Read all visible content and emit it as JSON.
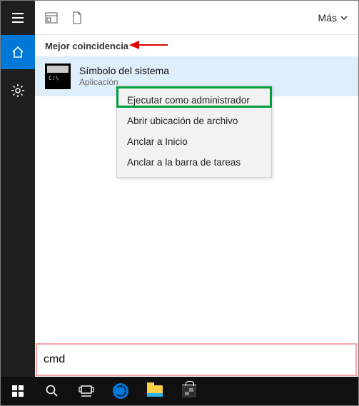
{
  "sidebar": {
    "items": [
      {
        "name": "hamburger"
      },
      {
        "name": "home"
      },
      {
        "name": "settings"
      }
    ]
  },
  "topbar": {
    "mas_label": "Más"
  },
  "section": {
    "best_match_label": "Mejor coincidencia"
  },
  "result": {
    "title": "Símbolo del sistema",
    "subtitle": "Aplicación"
  },
  "context_menu": {
    "items": [
      "Ejecutar como administrador",
      "Abrir ubicación de archivo",
      "Anclar a Inicio",
      "Anclar a la barra de tareas"
    ]
  },
  "search": {
    "value": "cmd",
    "placeholder": ""
  },
  "taskbar": {
    "items": [
      "start",
      "search",
      "task-view",
      "edge",
      "file-explorer",
      "store"
    ]
  },
  "annotations": {
    "red_arrow_target": "best-match-heading",
    "green_highlight_target": "context-run-as-admin",
    "red_box_target": "search-input"
  },
  "colors": {
    "accent": "#0078d7",
    "selection": "#dfeefb",
    "ann_green": "#009e3c",
    "ann_red": "#e00000",
    "ann_box": "#f4a6a5"
  }
}
